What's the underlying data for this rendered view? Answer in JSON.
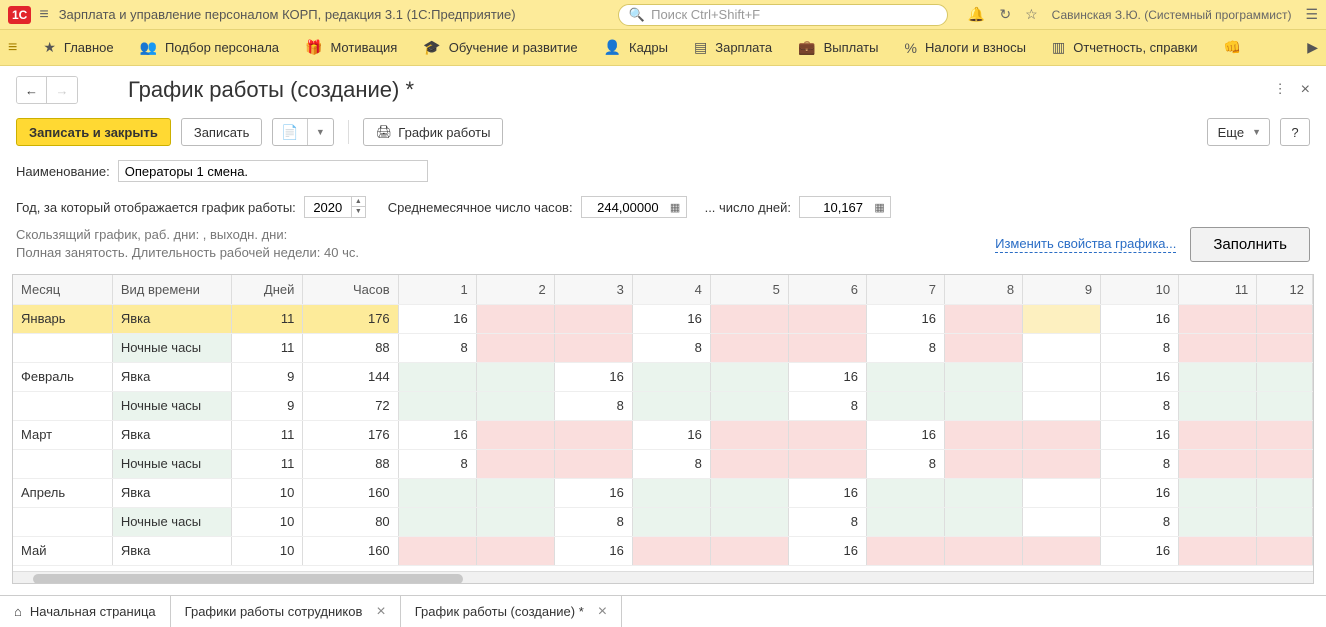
{
  "app": {
    "title": "Зарплата и управление персоналом КОРП, редакция 3.1  (1С:Предприятие)",
    "search_placeholder": "Поиск Ctrl+Shift+F",
    "user": "Савинская З.Ю. (Системный программист)"
  },
  "nav": {
    "items": [
      "Главное",
      "Подбор персонала",
      "Мотивация",
      "Обучение и развитие",
      "Кадры",
      "Зарплата",
      "Выплаты",
      "Налоги и взносы",
      "Отчетность, справки"
    ]
  },
  "page": {
    "title": "График работы (создание) *"
  },
  "toolbar": {
    "save_and_close": "Записать и закрыть",
    "save": "Записать",
    "schedule_report": "График работы",
    "more": "Еще",
    "help": "?"
  },
  "form": {
    "name_label": "Наименование:",
    "name_value": "Операторы 1 смена.",
    "year_label": "Год, за который отображается график работы:",
    "year_value": "2020",
    "avg_hours_label": "Среднемесячное число часов:",
    "avg_hours_value": "244,00000",
    "days_label": "... число дней:",
    "days_value": "10,167",
    "hint_line1": "Скользящий график, раб. дни: , выходн. дни:",
    "hint_line2": "Полная занятость. Длительность рабочей недели: 40 чс.",
    "change_props": "Изменить свойства графика...",
    "fill": "Заполнить"
  },
  "table": {
    "headers": {
      "month": "Месяц",
      "type": "Вид времени",
      "days": "Дней",
      "hours": "Часов"
    },
    "day_headers": [
      "1",
      "2",
      "3",
      "4",
      "5",
      "6",
      "7",
      "8",
      "9",
      "10",
      "11",
      "12"
    ],
    "rows": [
      {
        "month": "Январь",
        "type": "Явка",
        "days": "11",
        "hours": "176",
        "cells": [
          {
            "v": "16",
            "c": "white"
          },
          {
            "v": "",
            "c": "pink"
          },
          {
            "v": "",
            "c": "pink"
          },
          {
            "v": "16",
            "c": "white"
          },
          {
            "v": "",
            "c": "pink"
          },
          {
            "v": "",
            "c": "pink"
          },
          {
            "v": "16",
            "c": "white"
          },
          {
            "v": "",
            "c": "pink"
          },
          {
            "v": "",
            "c": "yellow"
          },
          {
            "v": "16",
            "c": "white"
          },
          {
            "v": "",
            "c": "pink"
          },
          {
            "v": "",
            "c": "pink"
          }
        ],
        "sel": true
      },
      {
        "month": "",
        "type": "Ночные часы",
        "days": "11",
        "hours": "88",
        "cells": [
          {
            "v": "8",
            "c": "white"
          },
          {
            "v": "",
            "c": "pink"
          },
          {
            "v": "",
            "c": "pink"
          },
          {
            "v": "8",
            "c": "white"
          },
          {
            "v": "",
            "c": "pink"
          },
          {
            "v": "",
            "c": "pink"
          },
          {
            "v": "8",
            "c": "white"
          },
          {
            "v": "",
            "c": "pink"
          },
          {
            "v": "",
            "c": "white"
          },
          {
            "v": "8",
            "c": "white"
          },
          {
            "v": "",
            "c": "pink"
          },
          {
            "v": "",
            "c": "pink"
          }
        ]
      },
      {
        "month": "Февраль",
        "type": "Явка",
        "days": "9",
        "hours": "144",
        "cells": [
          {
            "v": "",
            "c": "green"
          },
          {
            "v": "",
            "c": "green"
          },
          {
            "v": "16",
            "c": "white"
          },
          {
            "v": "",
            "c": "green"
          },
          {
            "v": "",
            "c": "green"
          },
          {
            "v": "16",
            "c": "white"
          },
          {
            "v": "",
            "c": "green"
          },
          {
            "v": "",
            "c": "green"
          },
          {
            "v": "",
            "c": "white"
          },
          {
            "v": "16",
            "c": "white"
          },
          {
            "v": "",
            "c": "green"
          },
          {
            "v": "",
            "c": "green"
          }
        ]
      },
      {
        "month": "",
        "type": "Ночные часы",
        "days": "9",
        "hours": "72",
        "cells": [
          {
            "v": "",
            "c": "green"
          },
          {
            "v": "",
            "c": "green"
          },
          {
            "v": "8",
            "c": "white"
          },
          {
            "v": "",
            "c": "green"
          },
          {
            "v": "",
            "c": "green"
          },
          {
            "v": "8",
            "c": "white"
          },
          {
            "v": "",
            "c": "green"
          },
          {
            "v": "",
            "c": "green"
          },
          {
            "v": "",
            "c": "white"
          },
          {
            "v": "8",
            "c": "white"
          },
          {
            "v": "",
            "c": "green"
          },
          {
            "v": "",
            "c": "green"
          }
        ]
      },
      {
        "month": "Март",
        "type": "Явка",
        "days": "11",
        "hours": "176",
        "cells": [
          {
            "v": "16",
            "c": "white"
          },
          {
            "v": "",
            "c": "pink"
          },
          {
            "v": "",
            "c": "pink"
          },
          {
            "v": "16",
            "c": "white"
          },
          {
            "v": "",
            "c": "pink"
          },
          {
            "v": "",
            "c": "pink"
          },
          {
            "v": "16",
            "c": "white"
          },
          {
            "v": "",
            "c": "pink"
          },
          {
            "v": "",
            "c": "pink"
          },
          {
            "v": "16",
            "c": "white"
          },
          {
            "v": "",
            "c": "pink"
          },
          {
            "v": "",
            "c": "pink"
          }
        ]
      },
      {
        "month": "",
        "type": "Ночные часы",
        "days": "11",
        "hours": "88",
        "cells": [
          {
            "v": "8",
            "c": "white"
          },
          {
            "v": "",
            "c": "pink"
          },
          {
            "v": "",
            "c": "pink"
          },
          {
            "v": "8",
            "c": "white"
          },
          {
            "v": "",
            "c": "pink"
          },
          {
            "v": "",
            "c": "pink"
          },
          {
            "v": "8",
            "c": "white"
          },
          {
            "v": "",
            "c": "pink"
          },
          {
            "v": "",
            "c": "pink"
          },
          {
            "v": "8",
            "c": "white"
          },
          {
            "v": "",
            "c": "pink"
          },
          {
            "v": "",
            "c": "pink"
          }
        ]
      },
      {
        "month": "Апрель",
        "type": "Явка",
        "days": "10",
        "hours": "160",
        "cells": [
          {
            "v": "",
            "c": "green"
          },
          {
            "v": "",
            "c": "green"
          },
          {
            "v": "16",
            "c": "white"
          },
          {
            "v": "",
            "c": "green"
          },
          {
            "v": "",
            "c": "green"
          },
          {
            "v": "16",
            "c": "white"
          },
          {
            "v": "",
            "c": "green"
          },
          {
            "v": "",
            "c": "green"
          },
          {
            "v": "",
            "c": "white"
          },
          {
            "v": "16",
            "c": "white"
          },
          {
            "v": "",
            "c": "green"
          },
          {
            "v": "",
            "c": "green"
          }
        ]
      },
      {
        "month": "",
        "type": "Ночные часы",
        "days": "10",
        "hours": "80",
        "cells": [
          {
            "v": "",
            "c": "green"
          },
          {
            "v": "",
            "c": "green"
          },
          {
            "v": "8",
            "c": "white"
          },
          {
            "v": "",
            "c": "green"
          },
          {
            "v": "",
            "c": "green"
          },
          {
            "v": "8",
            "c": "white"
          },
          {
            "v": "",
            "c": "green"
          },
          {
            "v": "",
            "c": "green"
          },
          {
            "v": "",
            "c": "white"
          },
          {
            "v": "8",
            "c": "white"
          },
          {
            "v": "",
            "c": "green"
          },
          {
            "v": "",
            "c": "green"
          }
        ]
      },
      {
        "month": "Май",
        "type": "Явка",
        "days": "10",
        "hours": "160",
        "cells": [
          {
            "v": "",
            "c": "pink"
          },
          {
            "v": "",
            "c": "pink"
          },
          {
            "v": "16",
            "c": "white"
          },
          {
            "v": "",
            "c": "pink"
          },
          {
            "v": "",
            "c": "pink"
          },
          {
            "v": "16",
            "c": "white"
          },
          {
            "v": "",
            "c": "pink"
          },
          {
            "v": "",
            "c": "pink"
          },
          {
            "v": "",
            "c": "pink"
          },
          {
            "v": "16",
            "c": "white"
          },
          {
            "v": "",
            "c": "pink"
          },
          {
            "v": "",
            "c": "pink"
          }
        ]
      }
    ]
  },
  "tabs": {
    "items": [
      {
        "label": "Начальная страница",
        "closable": false,
        "icon": "home"
      },
      {
        "label": "Графики работы сотрудников",
        "closable": true
      },
      {
        "label": "График работы (создание) *",
        "closable": true
      }
    ]
  }
}
